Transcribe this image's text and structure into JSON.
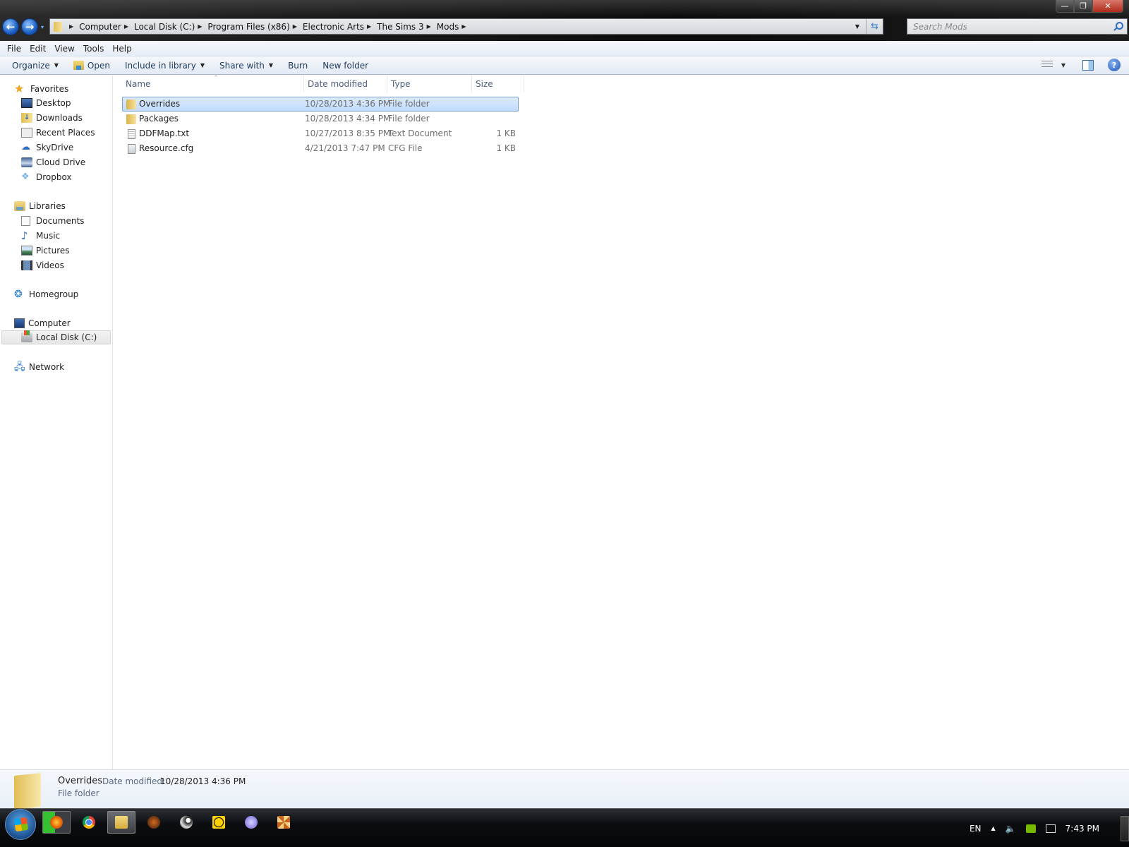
{
  "window": {
    "controls": {
      "minimize": "—",
      "maximize": "❐",
      "close": "✕"
    }
  },
  "navigation": {
    "back_icon": "←",
    "forward_icon": "→",
    "history_icon": "▾"
  },
  "address_bar": {
    "crumbs": [
      "Computer",
      "Local Disk (C:)",
      "Program Files (x86)",
      "Electronic Arts",
      "The Sims 3",
      "Mods"
    ],
    "separator_icon": "▶",
    "dropdown_icon": "▼",
    "refresh_icon": "⇆"
  },
  "search": {
    "placeholder": "Search Mods",
    "value": ""
  },
  "menubar": {
    "items": [
      "File",
      "Edit",
      "View",
      "Tools",
      "Help"
    ]
  },
  "commandbar": {
    "organize": "Organize",
    "open": "Open",
    "include_in_library": "Include in library",
    "share_with": "Share with",
    "burn": "Burn",
    "new_folder": "New folder",
    "caret": "▼",
    "help_glyph": "?"
  },
  "navpane": {
    "favorites": {
      "label": "Favorites",
      "items": [
        "Desktop",
        "Downloads",
        "Recent Places",
        "SkyDrive",
        "Cloud Drive",
        "Dropbox"
      ]
    },
    "libraries": {
      "label": "Libraries",
      "items": [
        "Documents",
        "Music",
        "Pictures",
        "Videos"
      ]
    },
    "homegroup": {
      "label": "Homegroup"
    },
    "computer": {
      "label": "Computer",
      "items": [
        "Local Disk (C:)"
      ],
      "selected": "Local Disk (C:)"
    },
    "network": {
      "label": "Network"
    },
    "glyphs": {
      "star": "★",
      "skydrive": "☁",
      "dropbox": "❖",
      "music": "♪",
      "homegroup": "❂",
      "network": "🖧"
    }
  },
  "filelist": {
    "columns": [
      "Name",
      "Date modified",
      "Type",
      "Size"
    ],
    "sort_indicator": "^",
    "rows": [
      {
        "name": "Overrides",
        "date": "10/28/2013 4:36 PM",
        "type": "File folder",
        "size": "",
        "icon": "folder",
        "selected": true
      },
      {
        "name": "Packages",
        "date": "10/28/2013 4:34 PM",
        "type": "File folder",
        "size": "",
        "icon": "folder",
        "selected": false
      },
      {
        "name": "DDFMap.txt",
        "date": "10/27/2013 8:35 PM",
        "type": "Text Document",
        "size": "1 KB",
        "icon": "text",
        "selected": false
      },
      {
        "name": "Resource.cfg",
        "date": "4/21/2013 7:47 PM",
        "type": "CFG File",
        "size": "1 KB",
        "icon": "cfg",
        "selected": false
      }
    ]
  },
  "details": {
    "name": "Overrides",
    "date_label": "Date modified:",
    "date_value": "10/28/2013 4:36 PM",
    "type": "File folder"
  },
  "taskbar": {
    "apps": [
      "Firefox",
      "Chrome",
      "Windows Explorer",
      "Diablo III",
      "Steam",
      "Norton",
      "uTorrent",
      "The Sims 3"
    ],
    "active_app": "Windows Explorer",
    "tray": {
      "language": "EN",
      "show_hidden": "▲",
      "volume": "🔈",
      "clock": "7:43 PM"
    }
  },
  "colors": {
    "selection_bg": "#cce1fb",
    "selection_border": "#7da2ce",
    "command_text": "#1e395b",
    "header_text": "#4c607a",
    "secondary_text": "#6d6d6d"
  }
}
